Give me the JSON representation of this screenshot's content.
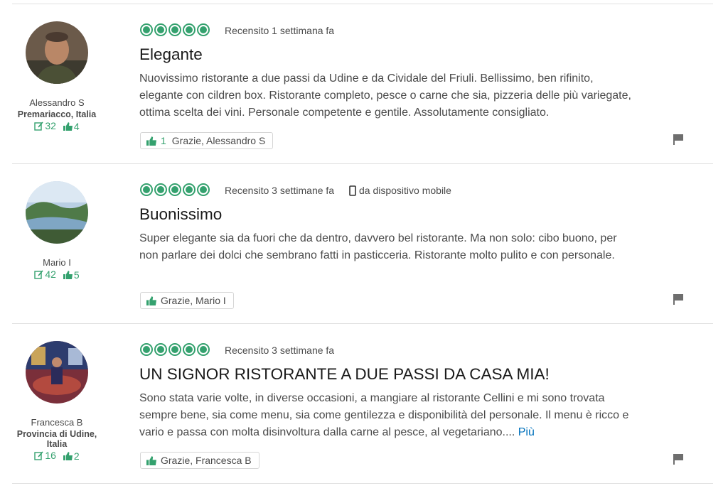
{
  "colors": {
    "accent": "#34a16e",
    "link": "#0071bc",
    "divider": "#e0e0e0"
  },
  "reviews": [
    {
      "user": {
        "name": "Alessandro S",
        "location": "Premariacco, Italia",
        "reviews": "32",
        "votes": "4"
      },
      "rating": 5,
      "date": "Recensito 1 settimana fa",
      "title": "Elegante",
      "text": "Nuovissimo ristorante a due passi da Udine e da Cividale del Friuli. Bellissimo, ben rifinito, elegante con cildren box. Ristorante completo, pesce o carne che sia, pizzeria delle più variegate, ottima scelta dei vini. Personale competente e gentile. Assolutamente consigliato.",
      "thanks_count": "1",
      "thanks_label": "Grazie, Alessandro S"
    },
    {
      "user": {
        "name": "Mario I",
        "reviews": "42",
        "votes": "5"
      },
      "rating": 5,
      "date": "Recensito 3 settimane fa",
      "device": "da dispositivo mobile",
      "title": "Buonissimo",
      "text": "Super elegante sia da fuori che da dentro, davvero bel ristorante. Ma non solo: cibo buono, per non parlare dei dolci che sembrano fatti in pasticceria. Ristorante molto pulito e con personale.",
      "thanks_label": "Grazie, Mario I"
    },
    {
      "user": {
        "name": "Francesca B",
        "location": "Provincia di Udine, Italia",
        "reviews": "16",
        "votes": "2"
      },
      "rating": 5,
      "date": "Recensito 3 settimane fa",
      "title": "UN SIGNOR RISTORANTE A DUE PASSI DA CASA MIA!",
      "text": "Sono stata varie volte, in diverse occasioni, a mangiare al ristorante Cellini e mi sono trovata sempre bene, sia come menu, sia come gentilezza e disponibilità del personale. Il menu è ricco e vario e passa con molta disinvoltura dalla carne al pesce, al vegetariano....",
      "more_label": "Più",
      "thanks_label": "Grazie, Francesca B"
    }
  ]
}
